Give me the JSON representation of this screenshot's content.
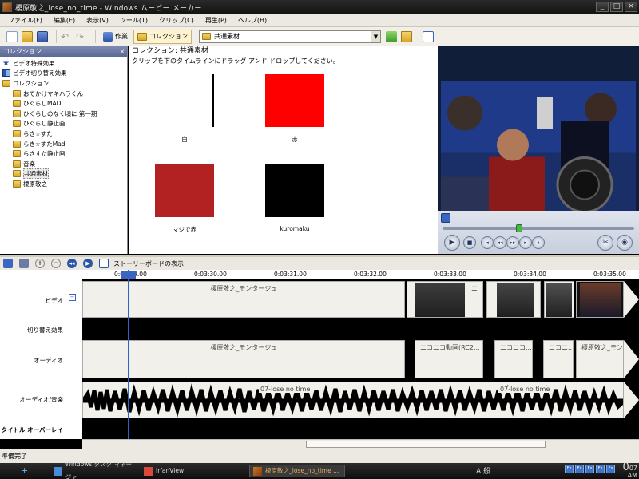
{
  "window": {
    "title": "榎原敬之_lose_no_time - Windows ムービー メーカー"
  },
  "menu": [
    "ファイル(F)",
    "編集(E)",
    "表示(V)",
    "ツール(T)",
    "クリップ(C)",
    "再生(P)",
    "ヘルプ(H)"
  ],
  "toolbar": {
    "tasks_label": "作業",
    "collections_label": "コレクション",
    "collection_combo_value": "共通素材"
  },
  "left_panel": {
    "title": "コレクション",
    "items": [
      {
        "label": "ビデオ特殊効果",
        "icon": "star-icon"
      },
      {
        "label": "ビデオ切り替え効果",
        "icon": "transition-icon"
      },
      {
        "label": "コレクション",
        "icon": "folder-icon"
      },
      {
        "label": "おでかけマキハラくん",
        "icon": "folder-icon"
      },
      {
        "label": "ひぐらしMAD",
        "icon": "folder-icon"
      },
      {
        "label": "ひぐらしのなく頃に 第一期",
        "icon": "folder-icon"
      },
      {
        "label": "ひぐらし静止画",
        "icon": "folder-icon"
      },
      {
        "label": "らき☆すた",
        "icon": "folder-icon"
      },
      {
        "label": "らき☆すたMad",
        "icon": "folder-icon"
      },
      {
        "label": "らきすた静止画",
        "icon": "folder-icon"
      },
      {
        "label": "音楽",
        "icon": "folder-icon"
      },
      {
        "label": "共通素材",
        "icon": "folder-icon"
      },
      {
        "label": "榎原敬之",
        "icon": "folder-icon"
      }
    ]
  },
  "content": {
    "heading": "コレクション: 共通素材",
    "instruction": "クリップを下のタイムラインにドラッグ アンド ドロップしてください。",
    "clips": [
      {
        "label": "白",
        "color": "#ffffff"
      },
      {
        "label": "赤",
        "color": "#ff0000"
      },
      {
        "label": "マジで赤",
        "color": "#b22222"
      },
      {
        "label": "kuromaku",
        "color": "#000000"
      }
    ]
  },
  "preview": {
    "seek_fraction": 0.42
  },
  "timeline_toolbar": {
    "storyboard_label": "ストーリーボードの表示"
  },
  "timeline": {
    "ruler_ticks": [
      "0:03:29.00",
      "0:03:30.00",
      "0:03:31.00",
      "0:03:32.00",
      "0:03:33.00",
      "0:03:34.00",
      "0:03:35.00"
    ],
    "track_labels": {
      "video": "ビデオ",
      "transition": "切り替え効果",
      "audio": "オーディオ",
      "audio_music": "オーディオ/音楽",
      "title_overlay": "タイトル オーバーレイ"
    },
    "video_clip_name": "榎原敬之_モンタージュ",
    "video_clip_short": "ニ",
    "audio_clips": [
      "榎原敬之_モンタージュ",
      "ニコニコ動画(RC2...",
      "ニコニコ...",
      "ニコニ...",
      "榎原敬之_モンタージュ"
    ],
    "music_clips": [
      "07-lose no time",
      "07-lose no time"
    ]
  },
  "status": {
    "text": "準備完了"
  },
  "taskbar": {
    "tasks": [
      "Windows タスク マネージャ",
      "IrfanView",
      "榎原敬之_lose_no_time ..."
    ],
    "ime": "A 般",
    "clock_hour": "0",
    "clock_min": "07",
    "clock_ampm": "AM"
  }
}
